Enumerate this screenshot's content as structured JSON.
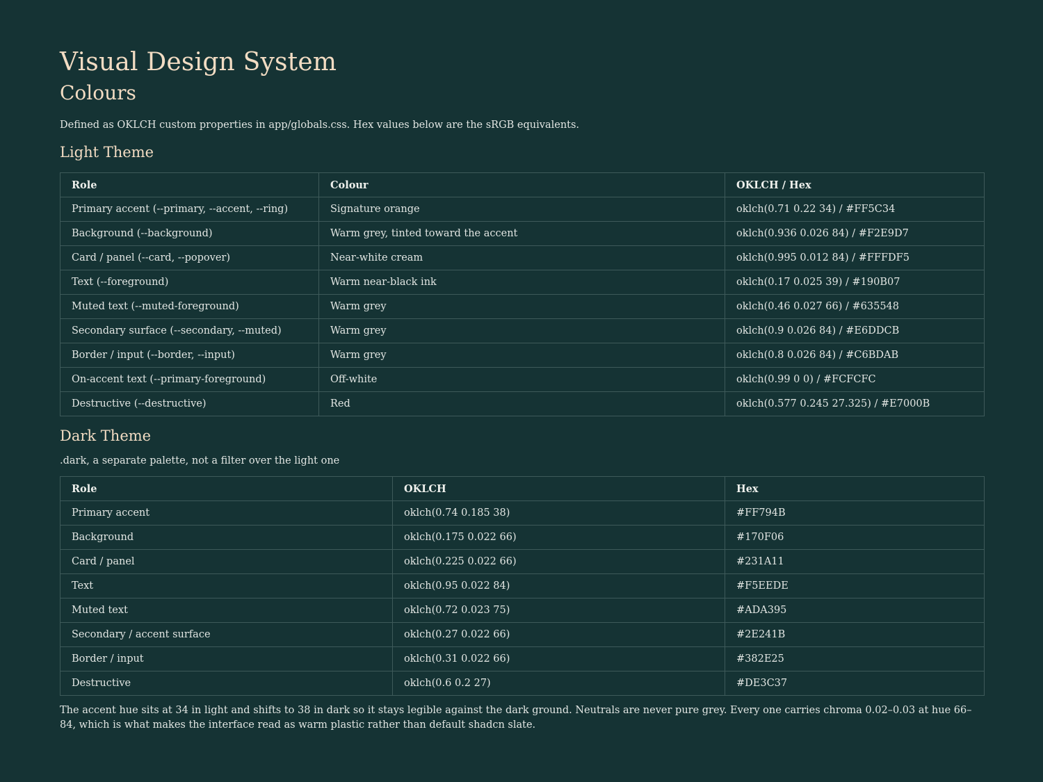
{
  "title": "Visual Design System",
  "section": "Colours",
  "intro": "Defined as OKLCH custom properties in app/globals.css. Hex values below are the sRGB equivalents.",
  "light": {
    "heading": "Light Theme",
    "headers": [
      "Role",
      "Colour",
      "OKLCH / Hex"
    ],
    "rows": [
      [
        "Primary accent (--primary, --accent, --ring)",
        "Signature orange",
        "oklch(0.71 0.22 34) / #FF5C34"
      ],
      [
        "Background (--background)",
        "Warm grey, tinted toward the accent",
        "oklch(0.936 0.026 84) / #F2E9D7"
      ],
      [
        "Card / panel (--card, --popover)",
        "Near-white cream",
        "oklch(0.995 0.012 84) / #FFFDF5"
      ],
      [
        "Text (--foreground)",
        "Warm near-black ink",
        "oklch(0.17 0.025 39) / #190B07"
      ],
      [
        "Muted text (--muted-foreground)",
        "Warm grey",
        "oklch(0.46 0.027 66) / #635548"
      ],
      [
        "Secondary surface (--secondary, --muted)",
        "Warm grey",
        "oklch(0.9 0.026 84) / #E6DDCB"
      ],
      [
        "Border / input (--border, --input)",
        "Warm grey",
        "oklch(0.8 0.026 84) / #C6BDAB"
      ],
      [
        "On-accent text (--primary-foreground)",
        "Off-white",
        "oklch(0.99 0 0) / #FCFCFC"
      ],
      [
        "Destructive (--destructive)",
        "Red",
        "oklch(0.577 0.245 27.325) / #E7000B"
      ]
    ]
  },
  "dark": {
    "heading": "Dark Theme",
    "subtitle": ".dark, a separate palette, not a filter over the light one",
    "headers": [
      "Role",
      "OKLCH",
      "Hex"
    ],
    "rows": [
      [
        "Primary accent",
        "oklch(0.74 0.185 38)",
        "#FF794B"
      ],
      [
        "Background",
        "oklch(0.175 0.022 66)",
        "#170F06"
      ],
      [
        "Card / panel",
        "oklch(0.225 0.022 66)",
        "#231A11"
      ],
      [
        "Text",
        "oklch(0.95 0.022 84)",
        "#F5EEDE"
      ],
      [
        "Muted text",
        "oklch(0.72 0.023 75)",
        "#ADA395"
      ],
      [
        "Secondary / accent surface",
        "oklch(0.27 0.022 66)",
        "#2E241B"
      ],
      [
        "Border / input",
        "oklch(0.31 0.022 66)",
        "#382E25"
      ],
      [
        "Destructive",
        "oklch(0.6 0.2 27)",
        "#DE3C37"
      ]
    ]
  },
  "footer": "The accent hue sits at 34 in light and shifts to 38 in dark so it stays legible against the dark ground. Neutrals are never pure grey. Every one carries chroma 0.02–0.03 at hue 66–84, which is what makes the interface read as warm plastic rather than default shadcn slate."
}
